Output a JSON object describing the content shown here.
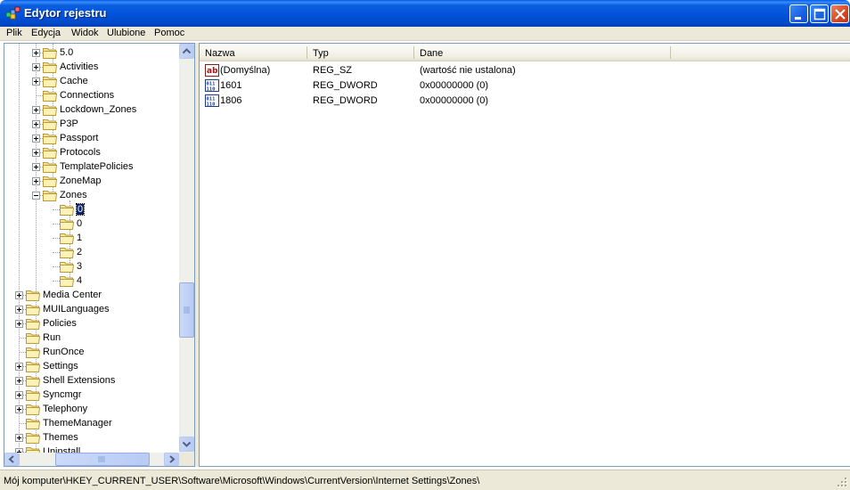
{
  "window": {
    "title": "Edytor rejestru",
    "accent_color": "#0054e3",
    "close_color": "#d9461f"
  },
  "menu": [
    "Plik",
    "Edycja",
    "Widok",
    "Ulubione",
    "Pomoc"
  ],
  "tree": [
    {
      "label": "5.0",
      "expander": "plus"
    },
    {
      "label": "Activities",
      "expander": "plus"
    },
    {
      "label": "Cache",
      "expander": "plus"
    },
    {
      "label": "Connections",
      "expander": "none"
    },
    {
      "label": "Lockdown_Zones",
      "expander": "plus"
    },
    {
      "label": "P3P",
      "expander": "plus"
    },
    {
      "label": "Passport",
      "expander": "plus"
    },
    {
      "label": "Protocols",
      "expander": "plus"
    },
    {
      "label": "TemplatePolicies",
      "expander": "plus"
    },
    {
      "label": "ZoneMap",
      "expander": "plus"
    },
    {
      "label": "Zones",
      "expander": "minus"
    },
    {
      "label": "0",
      "expander": "none",
      "selected": true
    },
    {
      "label": "0",
      "expander": "none"
    },
    {
      "label": "1",
      "expander": "none"
    },
    {
      "label": "2",
      "expander": "none"
    },
    {
      "label": "3",
      "expander": "none"
    },
    {
      "label": "4",
      "expander": "none"
    },
    {
      "label": "Media Center",
      "expander": "plus"
    },
    {
      "label": "MUILanguages",
      "expander": "plus"
    },
    {
      "label": "Policies",
      "expander": "plus"
    },
    {
      "label": "Run",
      "expander": "none"
    },
    {
      "label": "RunOnce",
      "expander": "none"
    },
    {
      "label": "Settings",
      "expander": "plus"
    },
    {
      "label": "Shell Extensions",
      "expander": "plus"
    },
    {
      "label": "Syncmgr",
      "expander": "plus"
    },
    {
      "label": "Telephony",
      "expander": "plus"
    },
    {
      "label": "ThemeManager",
      "expander": "none"
    },
    {
      "label": "Themes",
      "expander": "plus"
    },
    {
      "label": "Uninstall",
      "expander": "plus"
    }
  ],
  "list": {
    "columns": [
      "Nazwa",
      "Typ",
      "Dane"
    ],
    "rows": [
      {
        "icon": "string-value-icon",
        "name": "(Domyślna)",
        "type": "REG_SZ",
        "data": "(wartość nie ustalona)"
      },
      {
        "icon": "binary-value-icon",
        "name": "1601",
        "type": "REG_DWORD",
        "data": "0x00000000 (0)"
      },
      {
        "icon": "binary-value-icon",
        "name": "1806",
        "type": "REG_DWORD",
        "data": "0x00000000 (0)"
      }
    ]
  },
  "status": {
    "path": "Mój komputer\\HKEY_CURRENT_USER\\Software\\Microsoft\\Windows\\CurrentVersion\\Internet Settings\\Zones\\"
  }
}
